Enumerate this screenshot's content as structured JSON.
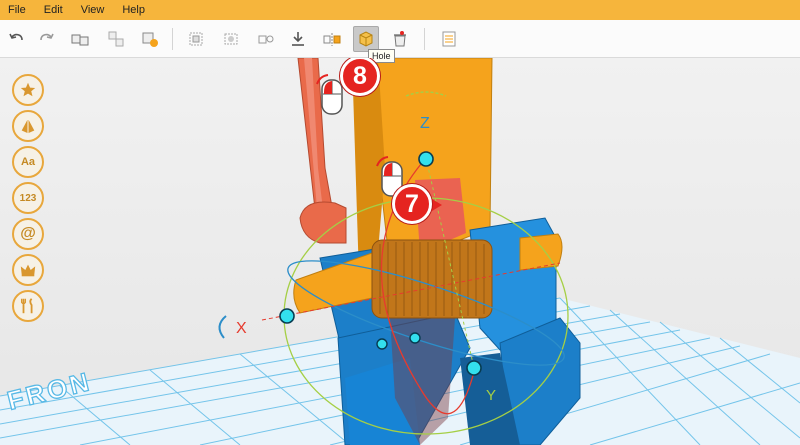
{
  "menu": {
    "items": [
      "File",
      "Edit",
      "View",
      "Help"
    ]
  },
  "toolbar": {
    "buttons": [
      {
        "icon": "undo-icon"
      },
      {
        "icon": "redo-icon"
      },
      {
        "icon": "group-icon"
      },
      {
        "icon": "ungroup-icon"
      },
      {
        "icon": "duplicate-icon"
      },
      {
        "icon": "align-icon"
      },
      {
        "icon": "ungroup-objects-icon"
      },
      {
        "icon": "measure-icon"
      },
      {
        "icon": "drop-to-ground-icon"
      },
      {
        "icon": "mirror-icon"
      },
      {
        "icon": "hole-icon",
        "active": true
      },
      {
        "icon": "delete-icon"
      },
      {
        "icon": "notes-icon"
      }
    ],
    "tooltip": "Hole"
  },
  "sidebar": {
    "items": [
      {
        "icon": "star-icon",
        "label": ""
      },
      {
        "icon": "shape-icon",
        "label": ""
      },
      {
        "icon": "text-icon",
        "label": "Aa"
      },
      {
        "icon": "numbers-icon",
        "label": "123"
      },
      {
        "icon": "at-symbol-icon",
        "label": "@"
      },
      {
        "icon": "crown-icon",
        "label": ""
      },
      {
        "icon": "tools-icon",
        "label": ""
      }
    ]
  },
  "viewport": {
    "axis_z": "Z",
    "axis_x": "X",
    "axis_y": "Y",
    "floor_label": "FRON",
    "step_badges": [
      "8",
      "7"
    ]
  },
  "colors": {
    "menubar": "#f6b53c",
    "accent": "#e8a73c",
    "model_orange": "#f5a31c",
    "model_blue": "#1c7fc9",
    "arm": "#e96a4a",
    "grid": "#58b9e6",
    "badge": "#e52420"
  }
}
